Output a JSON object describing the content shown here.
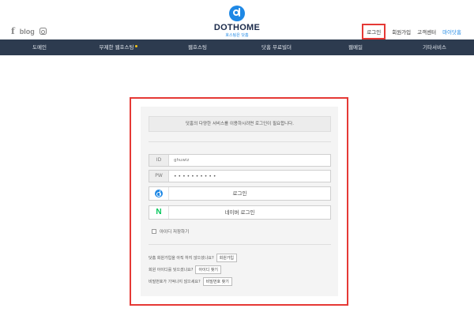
{
  "header": {
    "social": {
      "facebook": "f",
      "blog": "blog"
    },
    "logo": {
      "name": "DOTHOME",
      "tagline": "호스팅은 닷홈"
    },
    "topnav": [
      "로그인",
      "회원가입",
      "고객센터",
      "마이닷홈"
    ]
  },
  "menu": [
    "도메인",
    "무제한 웹호스팅",
    "웹호스팅",
    "닷홈 무료빌더",
    "웹메일",
    "기타서비스"
  ],
  "login": {
    "notice": "닷홈의 다양한 서비스를 이용하시려면 로그인이 필요합니다.",
    "id_label": "ID",
    "id_value": "ghuwiz",
    "pw_label": "PW",
    "pw_value": "••••••••••",
    "login_button": "로그인",
    "naver_button": "네이버 로그인",
    "save_id": "아이디 저장하기",
    "help": [
      {
        "text": "닷홈 회원가입을 아직 하지 않으셨나요?",
        "button": "회원가입"
      },
      {
        "text": "회원 아이디를 잊으셨나요?",
        "button": "아이디 찾기"
      },
      {
        "text": "비밀번호가 기억나지 않으세요?",
        "button": "비밀번호 찾기"
      }
    ]
  },
  "colors": {
    "accent": "#1e88e5",
    "menubar": "#2d3b4f",
    "highlight": "#e53935",
    "naver": "#03c75a"
  }
}
